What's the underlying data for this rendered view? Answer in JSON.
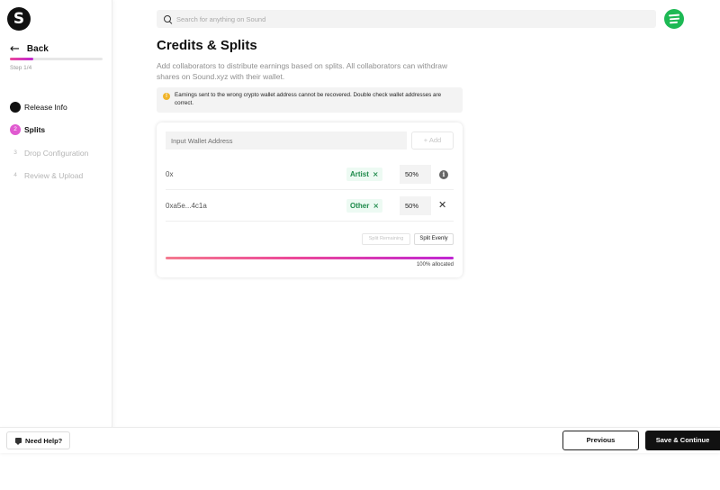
{
  "app": {
    "logo_letter": "S"
  },
  "sidebar": {
    "back_label": "Back",
    "progress_fraction": 0.25,
    "step_label": "Step 1/4",
    "steps": [
      {
        "number": "",
        "label": "Release Info",
        "state": "done"
      },
      {
        "number": "2",
        "label": "Splits",
        "state": "active"
      },
      {
        "number": "3",
        "label": "Drop Configuration",
        "state": "todo"
      },
      {
        "number": "4",
        "label": "Review & Upload",
        "state": "todo"
      }
    ]
  },
  "header": {
    "search_placeholder": "Search for anything on Sound"
  },
  "main": {
    "title": "Credits & Splits",
    "description": "Add collaborators to distribute earnings based on splits. All collaborators can withdraw shares on Sound.xyz with their wallet.",
    "warning_icon": "!",
    "warning": "Earnings sent to the wrong crypto wallet address cannot be recovered. Double check wallet addresses are correct."
  },
  "splits": {
    "wallet_placeholder": "Input Wallet Address",
    "add_label": "+ Add",
    "rows": [
      {
        "address": "0x",
        "role": "Artist",
        "percent": "50%"
      },
      {
        "address": "0xa5e...4c1a",
        "role": "Other",
        "percent": "50%"
      }
    ],
    "split_remaining_label": "Split Remaining",
    "split_evenly_label": "Split Evenly",
    "allocated_fraction": 1.0,
    "allocated_label": "100% allocated"
  },
  "footer": {
    "help_label": "Need Help?",
    "previous_label": "Previous",
    "save_label": "Save & Continue"
  },
  "colors": {
    "accent": "#e05ad0",
    "tag_green": "#1e8a4b",
    "spotify_green": "#1db954",
    "warning": "#f0b429"
  }
}
